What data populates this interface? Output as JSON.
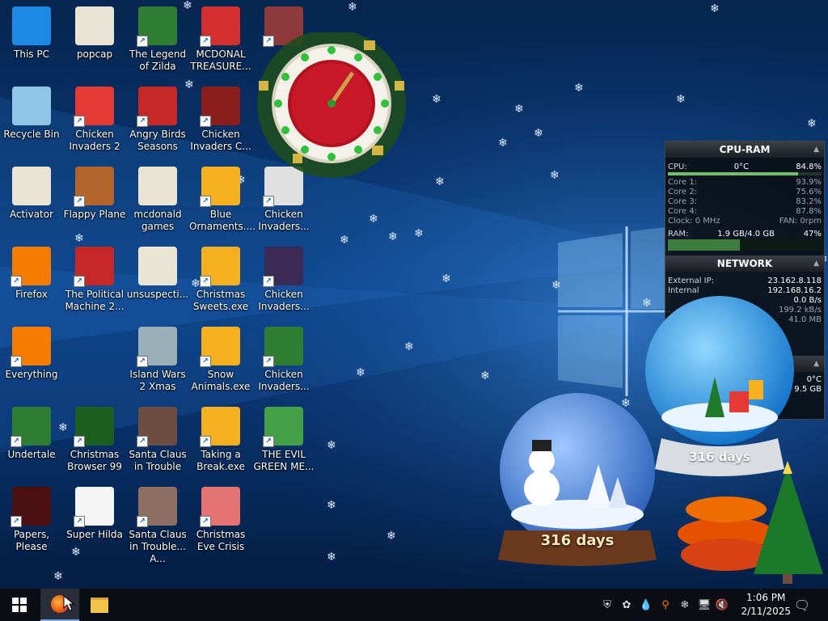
{
  "desktop": {
    "icons": [
      {
        "label": "This PC",
        "icon": "this-pc-icon",
        "color": "#1e88e5"
      },
      {
        "label": "popcap",
        "icon": "folder-icon",
        "color": "#e9e4d4"
      },
      {
        "label": "The Legend of Zilda",
        "icon": "game-icon",
        "color": "#2e7d32"
      },
      {
        "label": "MCDONAL TREASURE...",
        "icon": "mcdonalds-icon",
        "color": "#d32f2f"
      },
      {
        "label": "",
        "icon": "game-icon",
        "color": "#8e3a3a"
      },
      {
        "label": "Recycle Bin",
        "icon": "recycle-bin-icon",
        "color": "#8fc5e6"
      },
      {
        "label": "Chicken Invaders 2",
        "icon": "chicken-icon",
        "color": "#e53935"
      },
      {
        "label": "Angry Birds Seasons",
        "icon": "angry-birds-icon",
        "color": "#c62828"
      },
      {
        "label": "Chicken Invaders C...",
        "icon": "chicken-icon",
        "color": "#8b1d1d"
      },
      {
        "label": "Activator",
        "icon": "file-icon",
        "color": "#e9e4d4"
      },
      {
        "label": "Flappy Plane",
        "icon": "game-icon",
        "color": "#b4652c"
      },
      {
        "label": "mcdonald games",
        "icon": "file-icon",
        "color": "#e9e4d4"
      },
      {
        "label": "Blue Ornaments....",
        "icon": "box-icon",
        "color": "#f5b020"
      },
      {
        "label": "Chicken Invaders...",
        "icon": "chicken-icon",
        "color": "#e0e0e0"
      },
      {
        "label": "Firefox",
        "icon": "firefox-icon",
        "color": "#f57c00"
      },
      {
        "label": "The Political Machine 2...",
        "icon": "political-icon",
        "color": "#c62828"
      },
      {
        "label": "unsuspecti...",
        "icon": "file-icon",
        "color": "#e9e4d4"
      },
      {
        "label": "Christmas Sweets.exe",
        "icon": "box-icon",
        "color": "#f5b020"
      },
      {
        "label": "Chicken Invaders...",
        "icon": "chicken-icon",
        "color": "#3a2a55"
      },
      {
        "label": "Everything",
        "icon": "everything-icon",
        "color": "#f57c00"
      },
      {
        "label": "Island Wars 2 Xmas",
        "icon": "game-icon",
        "color": "#9ab0b8"
      },
      {
        "label": "Snow Animals.exe",
        "icon": "box-icon",
        "color": "#f5b020"
      },
      {
        "label": "Chicken Invaders...",
        "icon": "chicken-icon",
        "color": "#2e7d32"
      },
      {
        "label": "Undertale",
        "icon": "undertale-icon",
        "color": "#2e7d32"
      },
      {
        "label": "Christmas Browser 99",
        "icon": "tree-icon",
        "color": "#1b5e20"
      },
      {
        "label": "Santa Claus in Trouble",
        "icon": "santa-icon",
        "color": "#6d4c41"
      },
      {
        "label": "Taking a Break.exe",
        "icon": "box-icon",
        "color": "#f5b020"
      },
      {
        "label": "THE EVIL GREEN ME...",
        "icon": "messenger-icon",
        "color": "#43a047"
      },
      {
        "label": "Papers, Please",
        "icon": "papers-icon",
        "color": "#4a0f0f"
      },
      {
        "label": "Super Hilda",
        "icon": "game-icon",
        "color": "#f5f5f5"
      },
      {
        "label": "Santa Claus in Trouble... A...",
        "icon": "santa-icon",
        "color": "#8d6e63"
      },
      {
        "label": "Christmas Eve Crisis",
        "icon": "santa-icon",
        "color": "#e57373"
      }
    ]
  },
  "cpu_ram": {
    "title": "CPU-RAM",
    "cpu_label": "CPU:",
    "cpu_temp": "0°C",
    "cpu_value": "84.8%",
    "cpu_fraction": 0.848,
    "cores": [
      {
        "label": "Core 1:",
        "value": "93.9%"
      },
      {
        "label": "Core 2:",
        "value": "75.6%"
      },
      {
        "label": "Core 3:",
        "value": "83.2%"
      },
      {
        "label": "Core 4:",
        "value": "87.8%"
      }
    ],
    "clock": "Clock: 0 MHz",
    "fan": "FAN: 0rpm",
    "ram_label": "RAM:",
    "ram_value": "1.9 GB/4.0 GB",
    "ram_percent": "47%",
    "ram_fraction": 0.47
  },
  "network": {
    "title": "NETWORK",
    "external_label": "External IP:",
    "external_ip": "23.162.8.118",
    "internal_label": "Internal",
    "internal_ip": "192.168.16.2",
    "rate1": "0.0 B/s",
    "rate2": "199.2 kB/s",
    "total": "41.0 MB"
  },
  "drive": {
    "temp": "0°C",
    "size": "9.5 GB"
  },
  "clock_gadget": {
    "label": "clock"
  },
  "snow_globes": [
    {
      "label": "316 days"
    },
    {
      "label": "316 days"
    }
  ],
  "taskbar": {
    "time": "1:06 PM",
    "date": "2/11/2025"
  }
}
